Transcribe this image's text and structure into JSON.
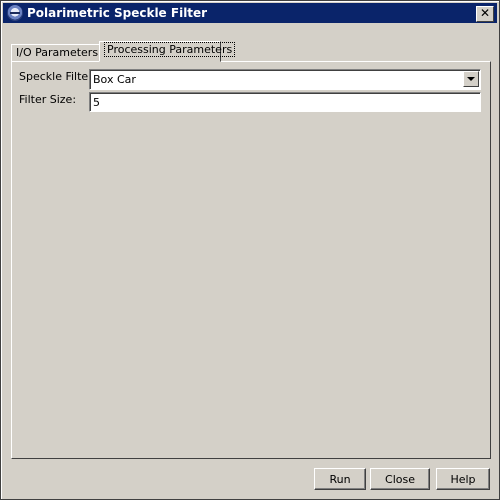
{
  "window": {
    "title": "Polarimetric Speckle Filter",
    "close_glyph": "✕"
  },
  "tabs": [
    {
      "label": "I/O Parameters",
      "selected": false
    },
    {
      "label": "Processing Parameters",
      "selected": true
    }
  ],
  "form": {
    "speckle_filter": {
      "label": "Speckle Filter:",
      "value": "Box Car"
    },
    "filter_size": {
      "label": "Filter Size:",
      "value": "5"
    }
  },
  "buttons": {
    "run": "Run",
    "close": "Close",
    "help": "Help"
  },
  "icons": {
    "app": "app-globe-icon",
    "dropdown": "chevron-down-icon"
  }
}
